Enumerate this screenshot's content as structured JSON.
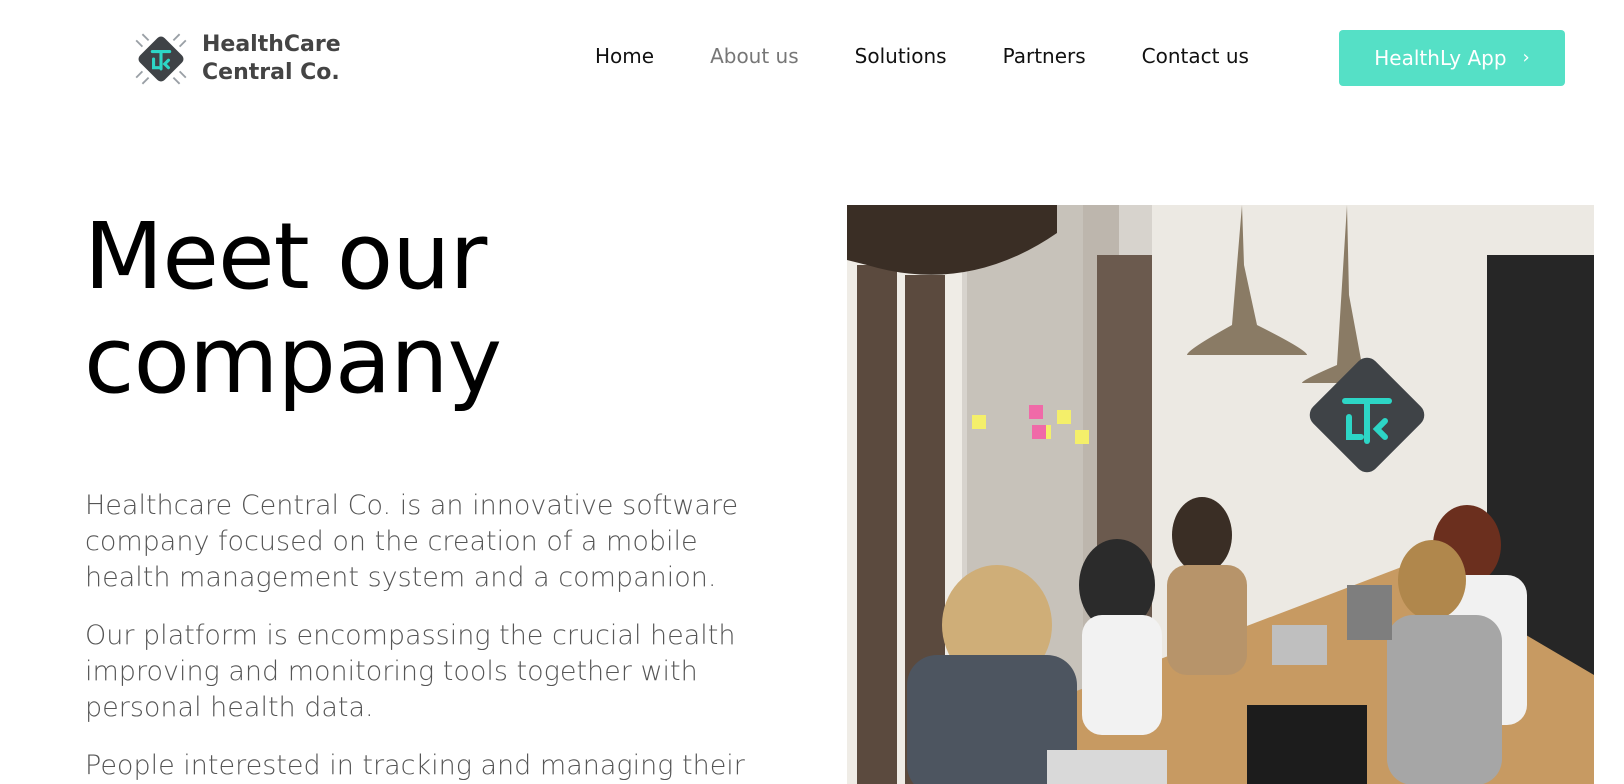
{
  "header": {
    "brand_line1": "HealthCare",
    "brand_line2": "Central Co.",
    "nav": [
      {
        "label": "Home",
        "active": false
      },
      {
        "label": "About us",
        "active": true
      },
      {
        "label": "Solutions",
        "active": false
      },
      {
        "label": "Partners",
        "active": false
      },
      {
        "label": "Contact us",
        "active": false
      }
    ],
    "cta_label": "HealthLy App",
    "cta_icon": "chevron-right-icon"
  },
  "hero": {
    "title_line1": "Meet our",
    "title_line2": "company",
    "paragraphs": [
      "Healthcare Central Co. is an innovative software company focused on the creation of a mobile health management system and a companion.",
      "Our platform is encompassing the crucial health improving and monitoring tools together with personal health data.",
      "People interested in tracking and managing their"
    ]
  },
  "image": {
    "alt_semantic": "team-meeting-photo",
    "logo_icon": "chip-logo-icon"
  },
  "colors": {
    "accent": "#55e0c6",
    "nav_active": "#777777",
    "body_text": "#555555",
    "logo_dark": "#3f4347",
    "logo_teal": "#2dd6c6"
  }
}
